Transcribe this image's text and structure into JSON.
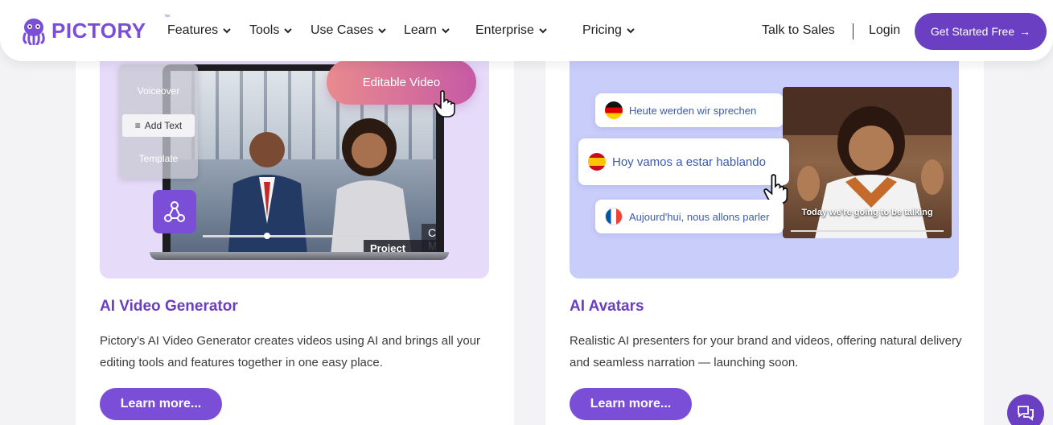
{
  "nav": {
    "logo_text": "PICTORY",
    "logo_tm": "™",
    "items": [
      {
        "label": "Features"
      },
      {
        "label": "Tools"
      },
      {
        "label": "Use Cases"
      },
      {
        "label": "Learn"
      },
      {
        "label": "Enterprise"
      },
      {
        "label": "Pricing"
      }
    ],
    "talk_to_sales": "Talk to Sales",
    "login": "Login",
    "cta": "Get Started Free",
    "cta_arrow": "→"
  },
  "cards": [
    {
      "title": "AI Video Generator",
      "description": "Pictory’s AI Video Generator creates videos using AI and brings all your editing tools and features together in one easy place.",
      "button": "Learn more...",
      "illustration": {
        "editable_pill": "Editable Video",
        "menu": [
          "Voiceover",
          "Add Text",
          "Template"
        ],
        "name_line1": "Chloe May",
        "name_line2": "Project Management"
      }
    },
    {
      "title": "AI Avatars",
      "description": "Realistic AI presenters for your brand and videos, offering natural delivery and seamless narration — launching soon.",
      "button": "Learn more...",
      "illustration": {
        "languages": [
          "Heute werden wir sprechen",
          "Hoy vamos a estar hablando",
          "Aujourd'hui, nous allons parler"
        ],
        "caption": "Today we're going to be talking"
      }
    }
  ],
  "colors": {
    "brand": "#6a3fc1",
    "button": "#7b4ed8",
    "left_media_bg": "#e6dcfa",
    "right_media_bg": "#c9cdfa"
  },
  "icons": [
    "octopus-logo-icon",
    "chevron-down-icon",
    "arrow-right-icon",
    "share-nodes-icon",
    "hand-pointer-icon",
    "chat-icon"
  ]
}
